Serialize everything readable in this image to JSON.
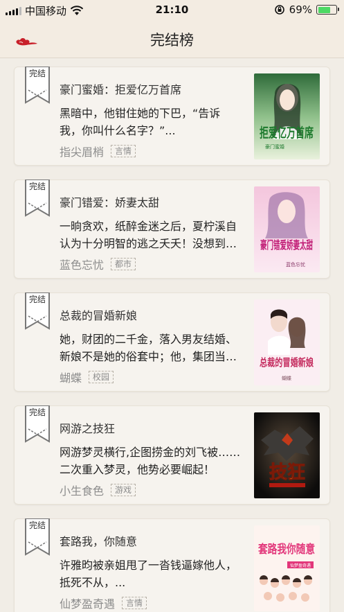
{
  "status_bar": {
    "carrier": "中国移动",
    "time": "21:10",
    "battery_percent": "69%",
    "battery_level": 0.69,
    "icons": [
      "signal-icon",
      "wifi-icon",
      "orientation-lock-icon",
      "battery-icon"
    ]
  },
  "nav": {
    "title": "完结榜",
    "back_icon": "cloud-back-icon"
  },
  "badge_label": "完结",
  "books": [
    {
      "title": "豪门蜜婚：拒爱亿万首席",
      "desc": "黑暗中，他钳住她的下巴，“告诉我，你叫什么名字？”...",
      "author": "指尖眉梢",
      "tag": "言情",
      "cover_text": "拒爱亿万首席",
      "cover_sub": "豪门蜜婚"
    },
    {
      "title": "豪门错爱：娇妻太甜",
      "desc": "一晌贪欢，纸醉金迷之后，夏柠溪自认为十分明智的逃之夭夭！没想到…",
      "author": "蓝色忘忧",
      "tag": "都市",
      "cover_text": "豪门错爱娇妻太甜",
      "cover_sub": "蓝色忘忧"
    },
    {
      "title": "总裁的冒婚新娘",
      "desc": "她，财团的二千金，落入男友结婚、新娘不是她的俗套中；他，集团当…",
      "author": "蝴蝶",
      "tag": "校园",
      "cover_text": "总裁的冒婚新娘",
      "cover_sub": "蝴蝶"
    },
    {
      "title": "网游之技狂",
      "desc": "网游梦灵横行,企图捞金的刘飞被……二次重入梦灵，他势必要崛起！",
      "author": "小生食色",
      "tag": "游戏",
      "cover_text": "技狂",
      "cover_sub": ""
    },
    {
      "title": "套路我，你随意",
      "desc": "许雅昀被亲姐甩了一沓钱逼嫁他人，抵死不从，...",
      "author": "仙梦盈奇遇",
      "tag": "言情",
      "cover_text": "套路我你随意",
      "cover_sub": "仙梦盈奇遇"
    }
  ],
  "colors": {
    "background": "#f1ede6",
    "card": "#f6f3ee",
    "accent_red": "#c8202a",
    "battery_green": "#4cd964"
  }
}
